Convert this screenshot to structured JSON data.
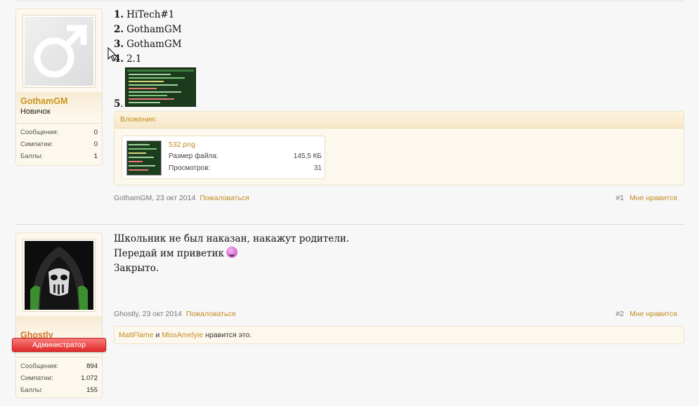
{
  "posts": [
    {
      "user": {
        "name": "GothamGM",
        "title": "Новичок",
        "stats": [
          {
            "label": "Сообщения:",
            "value": "0"
          },
          {
            "label": "Симпатии:",
            "value": "0"
          },
          {
            "label": "Баллы:",
            "value": "1"
          }
        ]
      },
      "list": [
        {
          "num": "1.",
          "text": "HiTech#1"
        },
        {
          "num": "2.",
          "text": "GothamGM"
        },
        {
          "num": "3.",
          "text": "GothamGM"
        },
        {
          "num": "4.",
          "text": "2.1"
        },
        {
          "num": "5",
          "text": "."
        }
      ],
      "attachments": {
        "title": "Вложения:",
        "file": {
          "name": "532.png",
          "size_label": "Размер файла:",
          "size_value": "145,5 КБ",
          "views_label": "Просмотров:",
          "views_value": "31"
        }
      },
      "meta": {
        "author_date": "GothamGM, 23 окт 2014",
        "report": "Пожаловаться",
        "number": "#1",
        "like": "Мне нравится"
      }
    },
    {
      "user": {
        "name": "Ghostly",
        "title": "Администратор",
        "stats": [
          {
            "label": "Сообщения:",
            "value": "894"
          },
          {
            "label": "Симпатии:",
            "value": "1.072"
          },
          {
            "label": "Баллы:",
            "value": "155"
          }
        ]
      },
      "lines": [
        "Школьник не был наказан, накажут родители.",
        "Передай им приветик",
        "Закрыто."
      ],
      "meta": {
        "author_date": "Ghostly, 23 окт 2014",
        "report": "Пожаловаться",
        "number": "#2",
        "like": "Мне нравится"
      },
      "likes": {
        "user1": "MattFlame",
        "and": "и",
        "user2": "MissAmelyie",
        "suffix": "нравится это."
      }
    }
  ],
  "colors": {
    "accent": "#c38c21",
    "admin_badge": "#e02a2a"
  }
}
